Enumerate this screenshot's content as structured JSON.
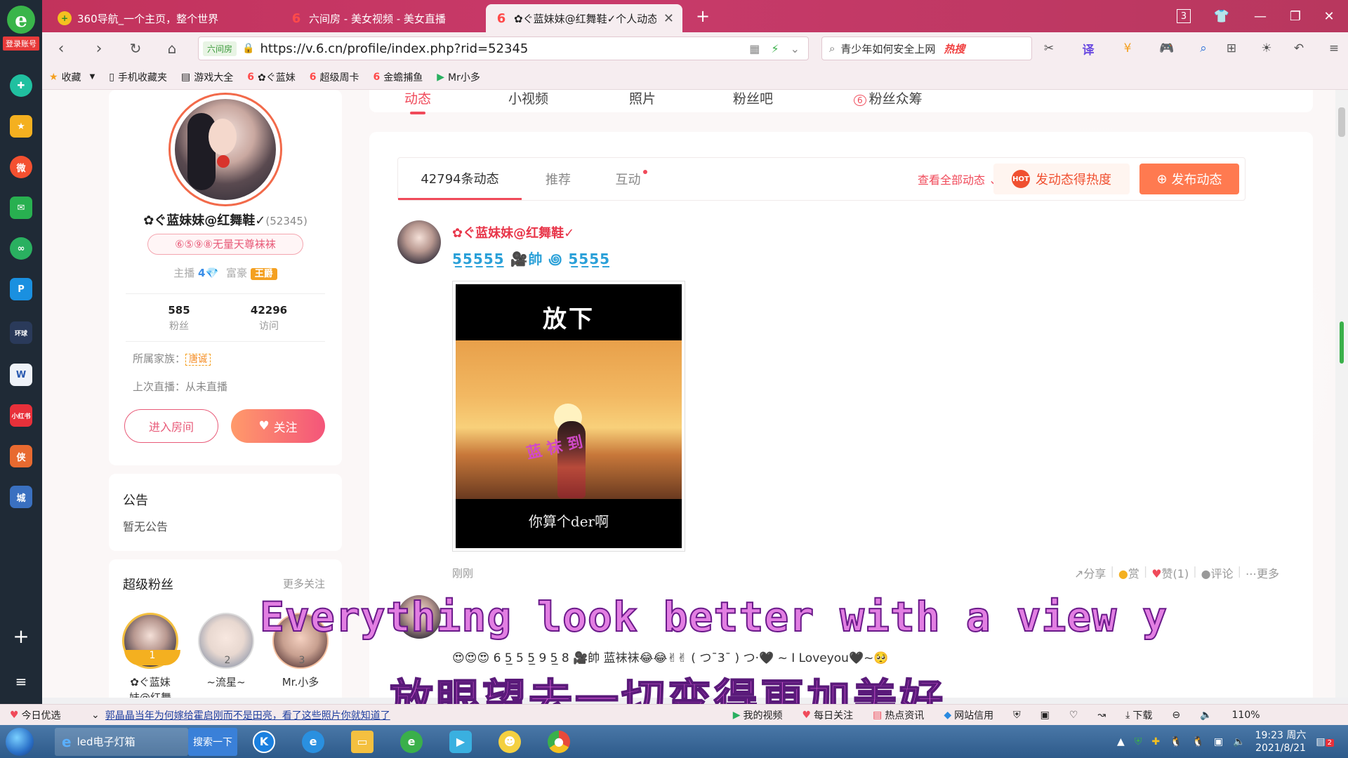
{
  "browser": {
    "tabs": [
      {
        "label": "360导航_一个主页，整个世界",
        "icon": "360-icon"
      },
      {
        "label": "六间房 - 美女视频 - 美女直播",
        "icon": "six-rooms-icon"
      },
      {
        "label": "✿ぐ蓝妹妹@红舞鞋✓个人动态",
        "icon": "six-rooms-icon"
      }
    ],
    "tab_count_badge": "3",
    "login_label": "登录账号",
    "security_label": "六间房",
    "url": "https://v.6.cn/profile/index.php?rid=52345",
    "search_text": "青少年如何安全上网",
    "search_hot": "热搜",
    "bookmarks": [
      {
        "label": "收藏",
        "icon": "star-icon"
      },
      {
        "label": "手机收藏夹",
        "icon": "phone-icon"
      },
      {
        "label": "游戏大全",
        "icon": "doc-icon"
      },
      {
        "label": "✿ぐ蓝妹",
        "icon": "six-rooms-icon"
      },
      {
        "label": "超级周卡",
        "icon": "six-rooms-icon"
      },
      {
        "label": "金蟾捕鱼",
        "icon": "six-rooms-icon"
      },
      {
        "label": "Mr小多",
        "icon": "green-app-icon"
      }
    ]
  },
  "page": {
    "tabs": [
      {
        "label": "动态"
      },
      {
        "label": "小视频"
      },
      {
        "label": "照片"
      },
      {
        "label": "粉丝吧"
      },
      {
        "label": "粉丝众筹"
      }
    ],
    "profile": {
      "name": "✿ぐ蓝妹妹@红舞鞋✓",
      "uid": "(52345)",
      "title": "⑥⑤⑨⑧无量天尊袜袜",
      "anchor_label": "主播",
      "anchor_level": "4",
      "rich_label": "富豪",
      "rich_badge": "王爵",
      "fans_count": "585",
      "fans_label": "粉丝",
      "visits_count": "42296",
      "visits_label": "访问",
      "family_label": "所属家族：",
      "family_tag": "唐诚",
      "last_live": "上次直播：从未直播",
      "enter_button": "进入房间",
      "follow_button": "关注"
    },
    "notice": {
      "title": "公告",
      "text": "暂无公告"
    },
    "super_fans": {
      "title": "超级粉丝",
      "more": "更多关注",
      "fans": [
        {
          "rank": "1",
          "name_line1": "✿ぐ蓝妹",
          "name_line2": "妹@红舞"
        },
        {
          "rank": "2",
          "name_line1": "~流星~",
          "name_line2": ""
        },
        {
          "rank": "3",
          "name_line1": "Mr.小多",
          "name_line2": ""
        }
      ]
    },
    "feed": {
      "tabs": [
        {
          "label": "42794条动态"
        },
        {
          "label": "推荐"
        },
        {
          "label": "互动"
        }
      ],
      "view_all": "查看全部动态",
      "hot_button": "发动态得热度",
      "hot_icon_text": "HOT",
      "post_button": "发布动态",
      "post": {
        "author": "✿ぐ蓝妹妹@红舞鞋✓",
        "badges": "5̲5̲5̲5̲5̲ 🎥帥 ꩜ 5̲5̲5̲5̲",
        "image_caption_top": "放下",
        "image_caption_mid": "蓝 袜 到",
        "image_caption_bottom": "你算个der啊",
        "time": "刚刚",
        "actions": {
          "share": "分享",
          "reward": "赏",
          "like": "赞(1)",
          "comment": "评论",
          "more": "更多"
        }
      },
      "post2_line": "😍😍😍 6 5̲ 5 5̲ 9 5̲ 8 🎥帥 蓝袜袜😂😂✌✌ ( つ¯3¯ ) つ·🖤 ~ I Loveyou🖤~🥺"
    }
  },
  "subtitles": {
    "english": "Everything look better with a view y",
    "chinese": "放眼望去一切变得更加美好"
  },
  "statusbar": {
    "today": "今日优选",
    "news": "郭晶晶当年为何嫁给霍启刚而不是田亮，看了这些照片你就知道了",
    "items": [
      "我的视频",
      "每日关注",
      "热点资讯",
      "网站信用"
    ],
    "download": "下载",
    "zoom": "110%"
  },
  "taskbar": {
    "ie_label": "led电子灯箱",
    "search_label": "搜索一下",
    "time": "19:23 周六",
    "date": "2021/8/21",
    "notify_count": "2"
  },
  "colors": {
    "accent": "#f04a5a",
    "tabbar": "#c2325b",
    "follow_gradient_start": "#ff9a6a",
    "follow_gradient_end": "#f4557a",
    "post_button": "#ff7a50"
  }
}
